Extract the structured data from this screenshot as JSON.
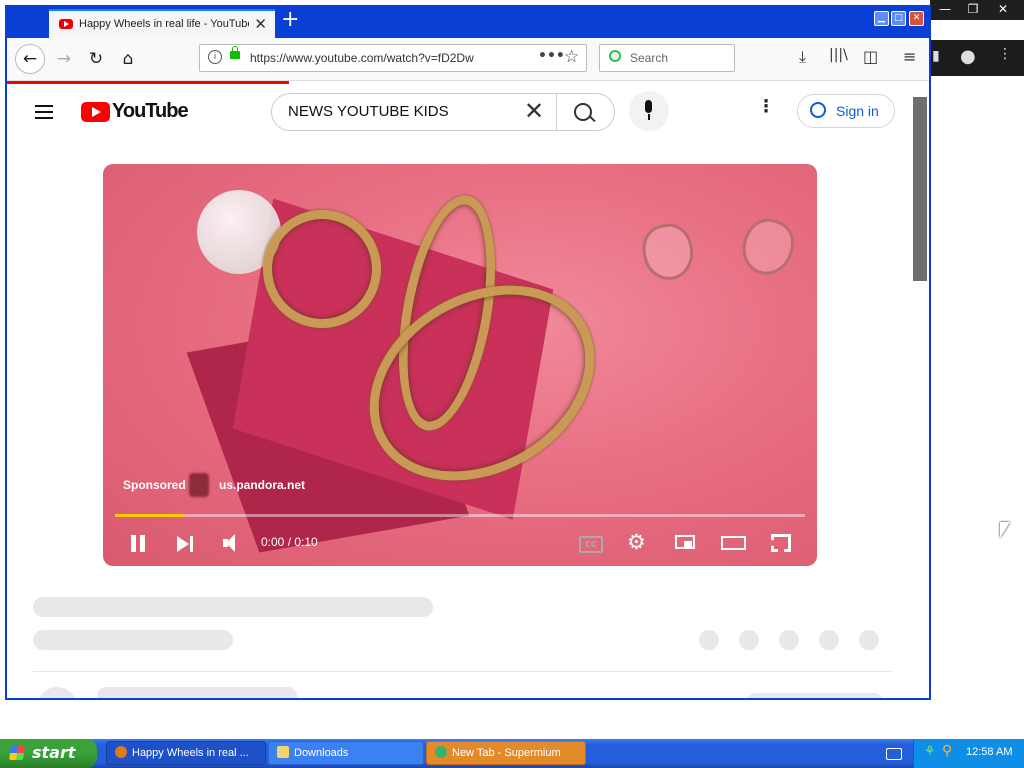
{
  "browser": {
    "tab_title": "Happy Wheels in real life - YouTube",
    "url": "https://www.youtube.com/watch?v=fD2Dw",
    "search_placeholder": "Search",
    "accent": "#0a3fd6"
  },
  "youtube": {
    "logo_text": "YouTube",
    "search_query": "NEWS YOUTUBE KIDS",
    "sign_in_label": "Sign in",
    "brand_color": "#ff0000",
    "player": {
      "sponsored_label": "Sponsored",
      "ad_domain": "us.pandora.net",
      "time": "0:00 / 0:10",
      "progress_fraction": 0.1
    }
  },
  "taskbar": {
    "start_label": "start",
    "tasks": [
      {
        "label": "Happy Wheels in real ..."
      },
      {
        "label": "Downloads"
      },
      {
        "label": "New Tab - Supermium"
      }
    ],
    "clock": "12:58 AM"
  }
}
